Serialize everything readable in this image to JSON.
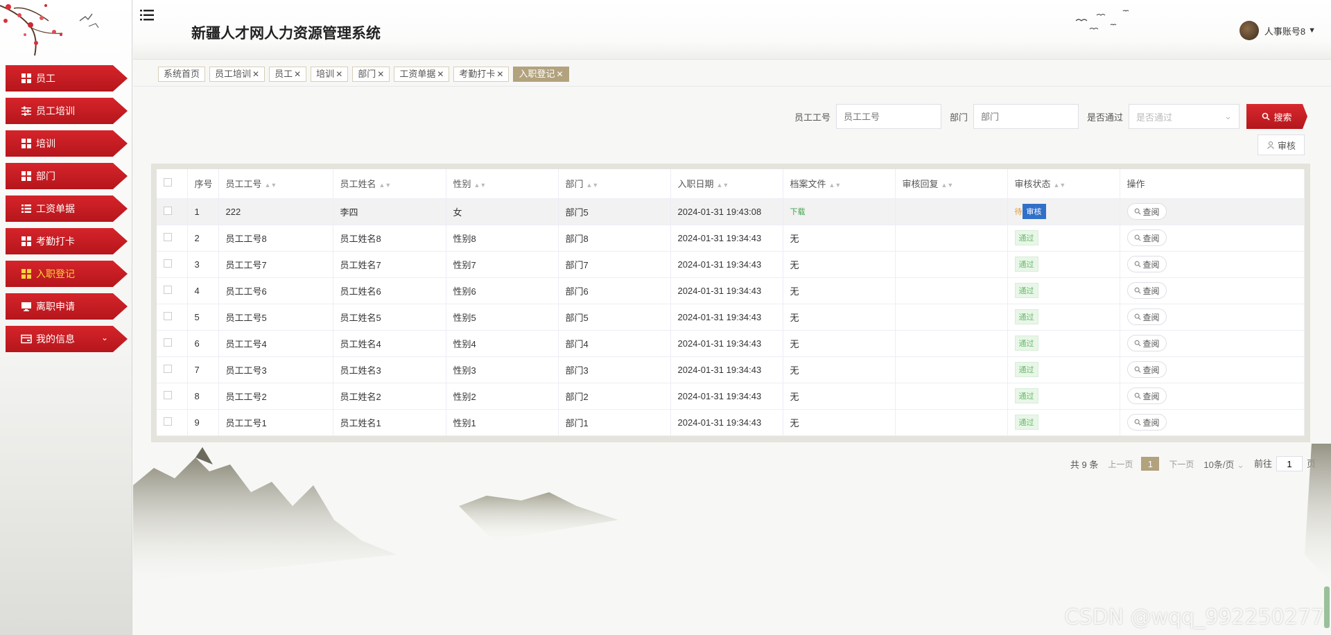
{
  "app": {
    "title": "新疆人才网人力资源管理系统"
  },
  "user": {
    "name": "人事账号8"
  },
  "sidebar": {
    "items": [
      {
        "label": "员工",
        "icon": "grid-icon"
      },
      {
        "label": "员工培训",
        "icon": "sliders-icon"
      },
      {
        "label": "培训",
        "icon": "grid-icon"
      },
      {
        "label": "部门",
        "icon": "grid-icon"
      },
      {
        "label": "工资单据",
        "icon": "list-icon"
      },
      {
        "label": "考勤打卡",
        "icon": "grid-icon"
      },
      {
        "label": "入职登记",
        "icon": "grid-icon",
        "active": true
      },
      {
        "label": "离职申请",
        "icon": "monitor-icon"
      },
      {
        "label": "我的信息",
        "icon": "card-icon",
        "expandable": true
      }
    ]
  },
  "tags": [
    {
      "label": "系统首页",
      "closable": false
    },
    {
      "label": "员工培训",
      "closable": true
    },
    {
      "label": "员工",
      "closable": true
    },
    {
      "label": "培训",
      "closable": true
    },
    {
      "label": "部门",
      "closable": true
    },
    {
      "label": "工资单据",
      "closable": true
    },
    {
      "label": "考勤打卡",
      "closable": true
    },
    {
      "label": "入职登记",
      "closable": true,
      "active": true
    }
  ],
  "search": {
    "emp_no_label": "员工工号",
    "emp_no_placeholder": "员工工号",
    "dept_label": "部门",
    "dept_placeholder": "部门",
    "passed_label": "是否通过",
    "passed_placeholder": "是否通过",
    "search_button": "搜索",
    "audit_button": "审核"
  },
  "table": {
    "columns": [
      "序号",
      "员工工号",
      "员工姓名",
      "性别",
      "部门",
      "入职日期",
      "档案文件",
      "审核回复",
      "审核状态",
      "操作"
    ],
    "view_label": "查阅",
    "rows": [
      {
        "no": "1",
        "emp_no": "222",
        "name": "李四",
        "gender": "女",
        "dept": "部门5",
        "date": "2024-01-31 19:43:08",
        "file": "下载",
        "reply": "",
        "status": "审核",
        "status_prefix": "待"
      },
      {
        "no": "2",
        "emp_no": "员工工号8",
        "name": "员工姓名8",
        "gender": "性别8",
        "dept": "部门8",
        "date": "2024-01-31 19:34:43",
        "file": "无",
        "reply": "",
        "status": "通过"
      },
      {
        "no": "3",
        "emp_no": "员工工号7",
        "name": "员工姓名7",
        "gender": "性别7",
        "dept": "部门7",
        "date": "2024-01-31 19:34:43",
        "file": "无",
        "reply": "",
        "status": "通过"
      },
      {
        "no": "4",
        "emp_no": "员工工号6",
        "name": "员工姓名6",
        "gender": "性别6",
        "dept": "部门6",
        "date": "2024-01-31 19:34:43",
        "file": "无",
        "reply": "",
        "status": "通过"
      },
      {
        "no": "5",
        "emp_no": "员工工号5",
        "name": "员工姓名5",
        "gender": "性别5",
        "dept": "部门5",
        "date": "2024-01-31 19:34:43",
        "file": "无",
        "reply": "",
        "status": "通过"
      },
      {
        "no": "6",
        "emp_no": "员工工号4",
        "name": "员工姓名4",
        "gender": "性别4",
        "dept": "部门4",
        "date": "2024-01-31 19:34:43",
        "file": "无",
        "reply": "",
        "status": "通过"
      },
      {
        "no": "7",
        "emp_no": "员工工号3",
        "name": "员工姓名3",
        "gender": "性别3",
        "dept": "部门3",
        "date": "2024-01-31 19:34:43",
        "file": "无",
        "reply": "",
        "status": "通过"
      },
      {
        "no": "8",
        "emp_no": "员工工号2",
        "name": "员工姓名2",
        "gender": "性别2",
        "dept": "部门2",
        "date": "2024-01-31 19:34:43",
        "file": "无",
        "reply": "",
        "status": "通过"
      },
      {
        "no": "9",
        "emp_no": "员工工号1",
        "name": "员工姓名1",
        "gender": "性别1",
        "dept": "部门1",
        "date": "2024-01-31 19:34:43",
        "file": "无",
        "reply": "",
        "status": "通过"
      }
    ]
  },
  "pagination": {
    "total": "共 9 条",
    "prev": "上一页",
    "current": "1",
    "next": "下一页",
    "page_size": "10条/页",
    "goto_prefix": "前往",
    "goto_value": "1",
    "goto_suffix": "页"
  },
  "watermark": "CSDN @wqq_992250277",
  "colors": {
    "accent_red": "#c41d23",
    "tag_active": "#b2a27d",
    "status_pass": "#6ab96a"
  }
}
